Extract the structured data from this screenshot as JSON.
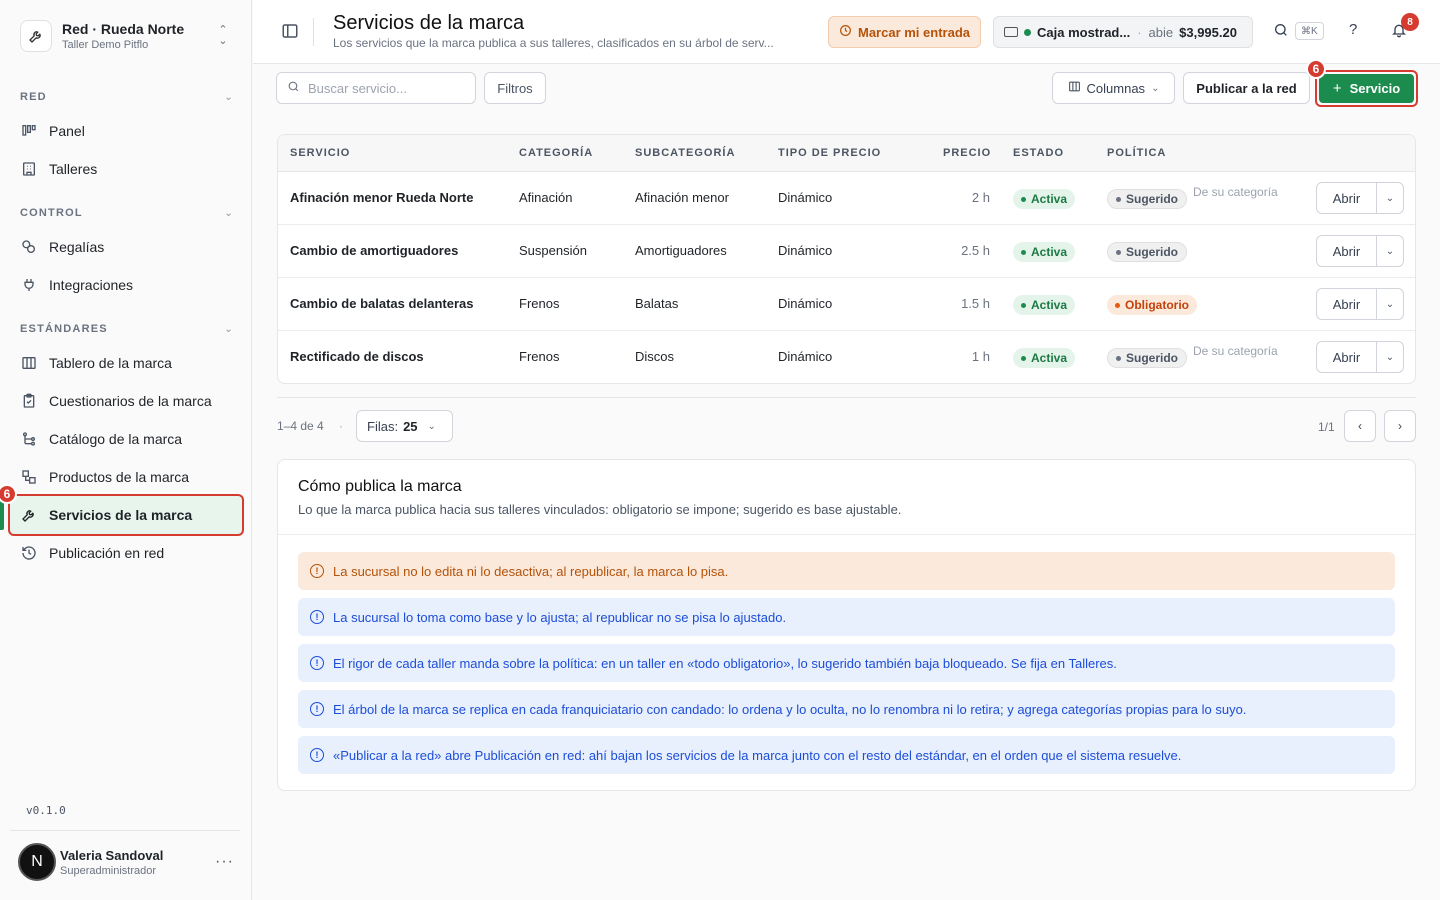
{
  "org": {
    "name": "Red · Rueda Norte",
    "sub": "Taller Demo Pitflo"
  },
  "sidebar": {
    "sections": [
      {
        "label": "RED"
      },
      {
        "label": "CONTROL"
      },
      {
        "label": "ESTÁNDARES"
      }
    ],
    "items": [
      {
        "label": "Panel",
        "icon": "kanban-icon"
      },
      {
        "label": "Talleres",
        "icon": "building-icon"
      },
      {
        "label": "Regalías",
        "icon": "coins-icon"
      },
      {
        "label": "Integraciones",
        "icon": "plug-icon"
      },
      {
        "label": "Tablero de la marca",
        "icon": "columns-icon"
      },
      {
        "label": "Cuestionarios de la marca",
        "icon": "clipboard-icon"
      },
      {
        "label": "Catálogo de la marca",
        "icon": "tree-icon"
      },
      {
        "label": "Productos de la marca",
        "icon": "package-icon"
      },
      {
        "label": "Servicios de la marca",
        "icon": "wrench-icon"
      },
      {
        "label": "Publicación en red",
        "icon": "history-icon"
      }
    ],
    "active_badge": "6",
    "version": "v0.1.0"
  },
  "user": {
    "initial": "N",
    "name": "Valeria Sandoval",
    "role": "Superadministrador"
  },
  "header": {
    "title": "Servicios de la marca",
    "subtitle": "Los servicios que la marca publica a sus talleres, clasificados en su árbol de serv...",
    "entrada_label": "Marcar mi entrada",
    "caja": {
      "name": "Caja mostrad...",
      "status": "abie",
      "amount": "$3,995.20"
    },
    "kbd": "⌘K",
    "help": "?",
    "notifications": "8"
  },
  "toolbar": {
    "search_placeholder": "Buscar servicio...",
    "filters_label": "Filtros",
    "columns_label": "Columnas",
    "publish_label": "Publicar a la red",
    "new_label": "Servicio",
    "new_badge": "6"
  },
  "table": {
    "headers": [
      "SERVICIO",
      "CATEGORÍA",
      "SUBCATEGORÍA",
      "TIPO DE PRECIO",
      "PRECIO",
      "ESTADO",
      "POLÍTICA"
    ],
    "rows": [
      {
        "service": "Afinación menor Rueda Norte",
        "category": "Afinación",
        "subcategory": "Afinación menor",
        "price_type": "Dinámico",
        "price": "2 h",
        "status": "Activa",
        "policy": "Sugerido",
        "policy_kind": "gray",
        "origin": "De su categoría",
        "action": "Abrir"
      },
      {
        "service": "Cambio de amortiguadores",
        "category": "Suspensión",
        "subcategory": "Amortiguadores",
        "price_type": "Dinámico",
        "price": "2.5 h",
        "status": "Activa",
        "policy": "Sugerido",
        "policy_kind": "gray",
        "origin": "",
        "action": "Abrir"
      },
      {
        "service": "Cambio de balatas delanteras",
        "category": "Frenos",
        "subcategory": "Balatas",
        "price_type": "Dinámico",
        "price": "1.5 h",
        "status": "Activa",
        "policy": "Obligatorio",
        "policy_kind": "orange",
        "origin": "",
        "action": "Abrir"
      },
      {
        "service": "Rectificado de discos",
        "category": "Frenos",
        "subcategory": "Discos",
        "price_type": "Dinámico",
        "price": "1 h",
        "status": "Activa",
        "policy": "Sugerido",
        "policy_kind": "gray",
        "origin": "De su categoría",
        "action": "Abrir"
      }
    ]
  },
  "pagination": {
    "range": "1–4 de 4",
    "rows_label": "Filas:",
    "rows_value": "25",
    "page": "1/1"
  },
  "info": {
    "title": "Cómo publica la marca",
    "subtitle": "Lo que la marca publica hacia sus talleres vinculados: obligatorio se impone; sugerido es base ajustable.",
    "alerts": [
      {
        "kind": "warn",
        "text": "La sucursal no lo edita ni lo desactiva; al republicar, la marca lo pisa."
      },
      {
        "kind": "info",
        "text": "La sucursal lo toma como base y lo ajusta; al republicar no se pisa lo ajustado."
      },
      {
        "kind": "info",
        "text": "El rigor de cada taller manda sobre la política: en un taller en «todo obligatorio», lo sugerido también baja bloqueado. Se fija en Talleres."
      },
      {
        "kind": "info",
        "text": "El árbol de la marca se replica en cada franquiciatario con candado: lo ordena y lo oculta, no lo renombra ni lo retira; y agrega categorías propias para lo suyo."
      },
      {
        "kind": "info",
        "text": "«Publicar a la red» abre Publicación en red: ahí bajan los servicios de la marca junto con el resto del estándar, en el orden que el sistema resuelve."
      }
    ]
  },
  "colors": {
    "accent": "#1c8c4e",
    "highlight": "#d63b30",
    "warn": "#b45309",
    "info": "#1d4ed8"
  }
}
